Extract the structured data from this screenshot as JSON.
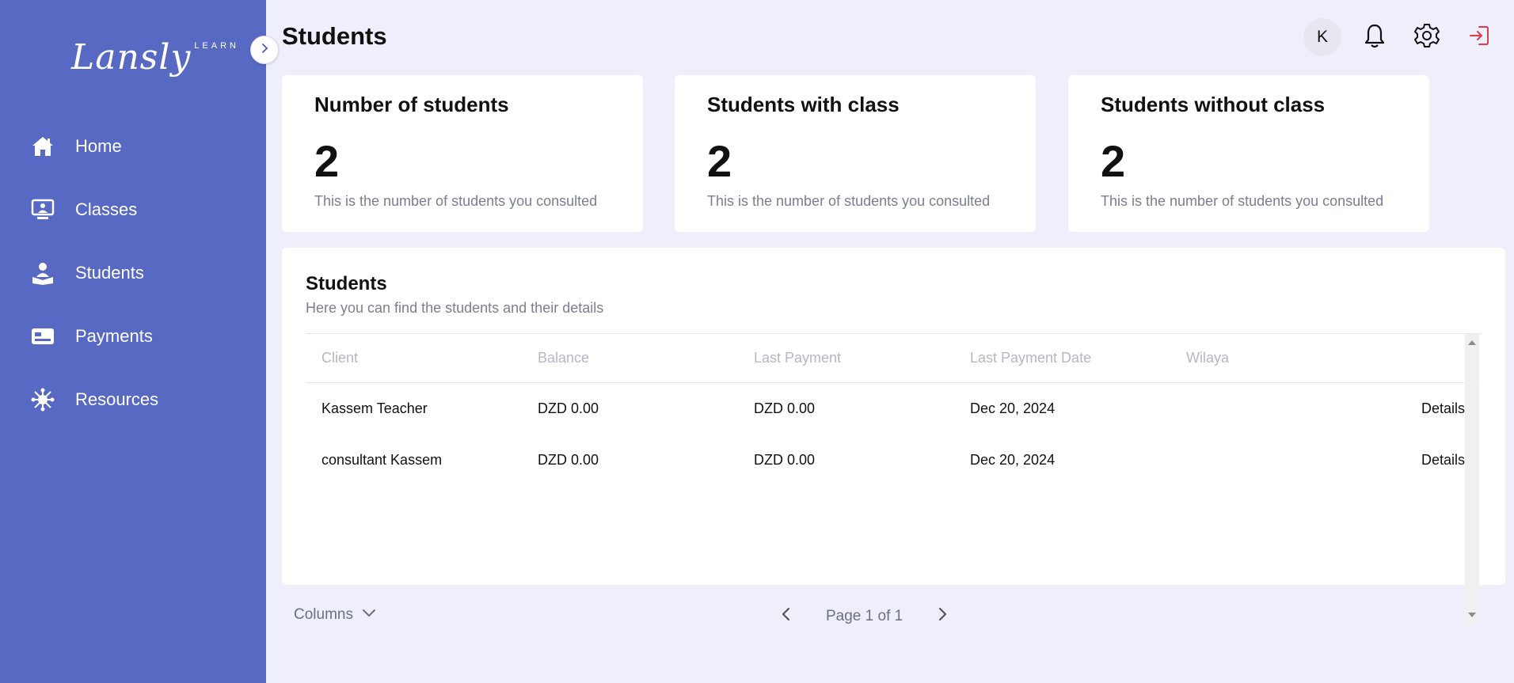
{
  "app": {
    "logo_main": "Lansly",
    "logo_sub": "LEARN",
    "brand_color": "#5869c4"
  },
  "sidebar": {
    "items": [
      {
        "label": "Home",
        "icon": "home-icon"
      },
      {
        "label": "Classes",
        "icon": "classroom-icon"
      },
      {
        "label": "Students",
        "icon": "student-icon"
      },
      {
        "label": "Payments",
        "icon": "payment-card-icon"
      },
      {
        "label": "Resources",
        "icon": "resources-icon"
      }
    ]
  },
  "header": {
    "title": "Students",
    "avatar_initial": "K"
  },
  "stats": [
    {
      "title": "Number of students",
      "value": "2",
      "desc": "This is the number of students you consulted"
    },
    {
      "title": "Students with class",
      "value": "2",
      "desc": "This is the number of students you consulted"
    },
    {
      "title": "Students without class",
      "value": "2",
      "desc": "This is the number of students you consulted"
    }
  ],
  "panel": {
    "title": "Students",
    "subtitle": "Here you can find the students and their details"
  },
  "table": {
    "columns": [
      "Client",
      "Balance",
      "Last Payment",
      "Last Payment Date",
      "Wilaya"
    ],
    "rows": [
      {
        "client": "Kassem Teacher",
        "balance": "DZD 0.00",
        "last_payment": "DZD 0.00",
        "last_payment_date": "Dec 20, 2024",
        "wilaya": "",
        "action": "Details"
      },
      {
        "client": "consultant Kassem",
        "balance": "DZD 0.00",
        "last_payment": "DZD 0.00",
        "last_payment_date": "Dec 20, 2024",
        "wilaya": "",
        "action": "Details"
      }
    ]
  },
  "footer": {
    "columns_label": "Columns",
    "page_text": "Page 1 of 1"
  }
}
